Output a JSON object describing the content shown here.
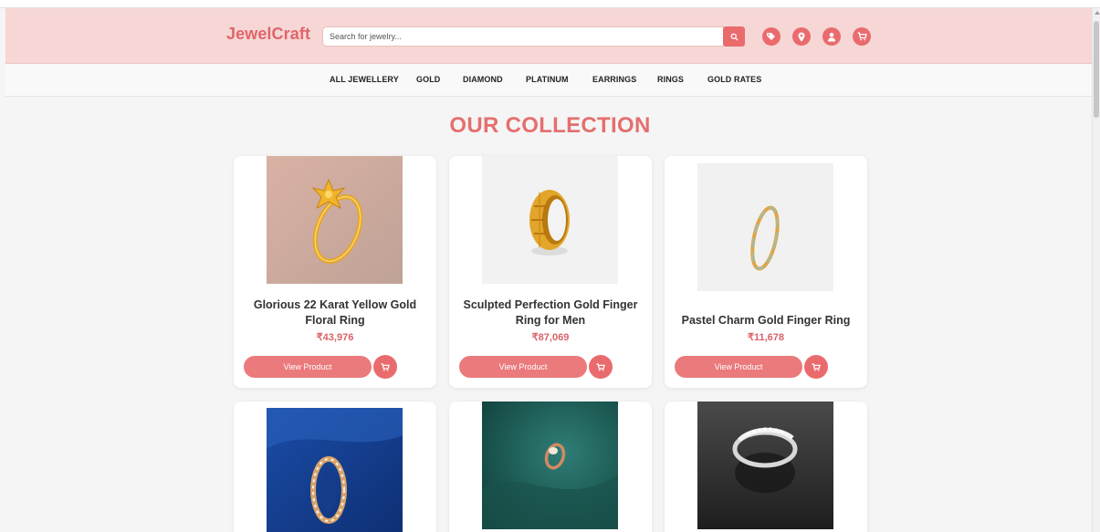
{
  "brand": {
    "name": "JewelCraft"
  },
  "search": {
    "placeholder": "Search for jewelry..."
  },
  "header_icons": [
    "search-icon",
    "tag-icon",
    "location-pin-icon",
    "user-icon",
    "cart-icon"
  ],
  "nav": {
    "items": [
      {
        "label": "ALL JEWELLERY"
      },
      {
        "label": "GOLD"
      },
      {
        "label": "DIAMOND"
      },
      {
        "label": "PLATINUM"
      },
      {
        "label": "EARRINGS"
      },
      {
        "label": "RINGS"
      },
      {
        "label": "GOLD RATES"
      }
    ]
  },
  "collection": {
    "title": "OUR COLLECTION",
    "view_label": "View Product",
    "products": [
      {
        "name": "Glorious 22 Karat Yellow Gold Floral Ring",
        "price": "₹43,976"
      },
      {
        "name": "Sculpted Perfection Gold Finger Ring for Men",
        "price": "₹87,069"
      },
      {
        "name": "Pastel Charm Gold Finger Ring",
        "price": "₹11,678"
      },
      {
        "name": "",
        "price": ""
      },
      {
        "name": "",
        "price": ""
      },
      {
        "name": "",
        "price": ""
      }
    ]
  },
  "colors": {
    "accent": "#ea6b6e",
    "header_bg": "#f6d7d5",
    "title": "#e56f6f",
    "price": "#d9626a"
  }
}
